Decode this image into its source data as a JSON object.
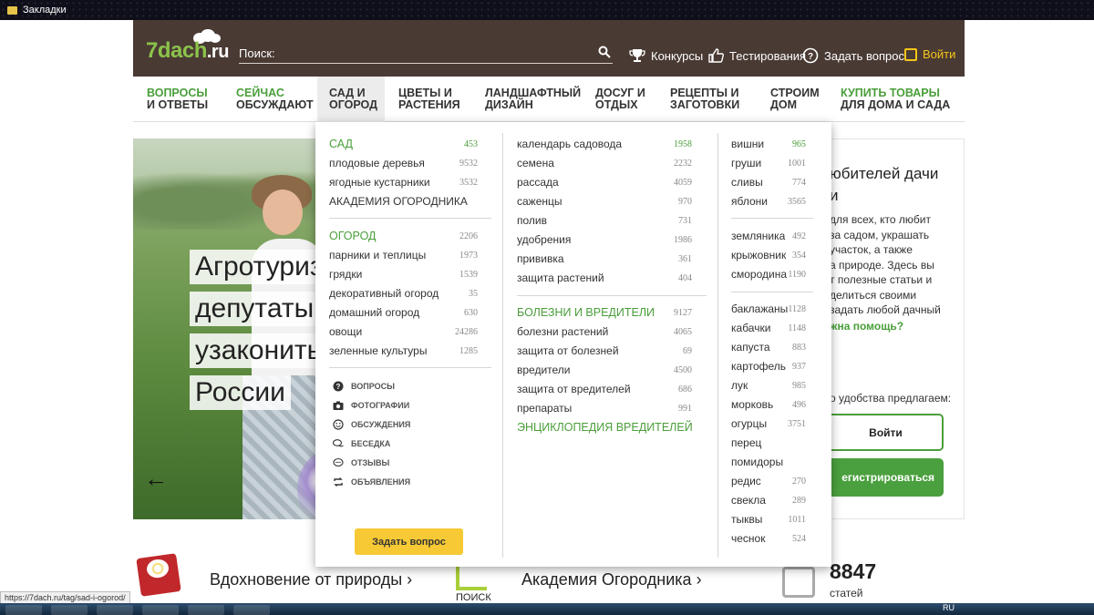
{
  "os": {
    "window_title": "Закладки"
  },
  "header": {
    "logo_main": "7dach",
    "logo_tld": ".ru",
    "search_placeholder": "Поиск:",
    "links": {
      "contests": "Конкурсы",
      "tests": "Тестирования",
      "ask": "Задать вопрос",
      "login": "Войти"
    }
  },
  "nav": [
    {
      "l1": "ВОПРОСЫ",
      "l2": "И ОТВЕТЫ"
    },
    {
      "l1": "СЕЙЧАС",
      "l2": "ОБСУЖДАЮТ"
    },
    {
      "l1": "САД И",
      "l2": "ОГОРОД"
    },
    {
      "l1": "ЦВЕТЫ И",
      "l2": "РАСТЕНИЯ"
    },
    {
      "l1": "ЛАНДШАФТНЫЙ",
      "l2": "ДИЗАЙН"
    },
    {
      "l1": "ДОСУГ И",
      "l2": "ОТДЫХ"
    },
    {
      "l1": "РЕЦЕПТЫ И",
      "l2": "ЗАГОТОВКИ"
    },
    {
      "l1": "СТРОИМ",
      "l2": "ДОМ"
    },
    {
      "l1": "КУПИТЬ ТОВАРЫ",
      "l2": "ДЛЯ ДОМА И САДА"
    }
  ],
  "hero": {
    "lines": [
      "Агротуриз",
      "депутаты",
      "узаконить",
      "России"
    ],
    "arrow": "←"
  },
  "right_panel": {
    "title_l1": "юбителей дачи",
    "title_l2": "и",
    "text": [
      "для всех, кто любит",
      "за садом, украшать",
      "участок, а также",
      "а природе. Здесь вы",
      "т полезные статьи и",
      "делиться своими",
      "задать любой дачный"
    ],
    "help": "жна помощь?",
    "offer": "о удобства предлагаем:",
    "login_btn": "Войти",
    "register_btn": "егистрироваться"
  },
  "dropdown": {
    "col1": {
      "sad_head": "САД",
      "sad_count": "453",
      "sad_items": [
        {
          "label": "плодовые деревья",
          "count": "9532"
        },
        {
          "label": "ягодные кустарники",
          "count": "3532"
        }
      ],
      "academy": "АКАДЕМИЯ ОГОРОДНИКА",
      "ogorod_head": "ОГОРОД",
      "ogorod_count": "2206",
      "ogorod_items": [
        {
          "label": "парники и теплицы",
          "count": "1973"
        },
        {
          "label": "грядки",
          "count": "1539"
        },
        {
          "label": "декоративный огород",
          "count": "35"
        },
        {
          "label": "домашний огород",
          "count": "630"
        },
        {
          "label": "овощи",
          "count": "24286"
        },
        {
          "label": "зеленные культуры",
          "count": "1285"
        }
      ],
      "links": [
        "вопросы",
        "фотографии",
        "обсуждения",
        "беседка",
        "отзывы",
        "объявления"
      ],
      "ask_button": "Задать вопрос"
    },
    "col2": {
      "items": [
        {
          "label": "календарь садовода",
          "count": "1958"
        },
        {
          "label": "семена",
          "count": "2232"
        },
        {
          "label": "рассада",
          "count": "4059"
        },
        {
          "label": "саженцы",
          "count": "970"
        },
        {
          "label": "полив",
          "count": "731"
        },
        {
          "label": "удобрения",
          "count": "1986"
        },
        {
          "label": "прививка",
          "count": "361"
        },
        {
          "label": "защита растений",
          "count": "404"
        }
      ],
      "pests_head": "БОЛЕЗНИ И ВРЕДИТЕЛИ",
      "pests_count": "9127",
      "pests_items": [
        {
          "label": "болезни растений",
          "count": "4065"
        },
        {
          "label": "защита от болезней",
          "count": "69"
        },
        {
          "label": "вредители",
          "count": "4500"
        },
        {
          "label": "защита от вредителей",
          "count": "686"
        },
        {
          "label": "препараты",
          "count": "991"
        }
      ],
      "encyclopedia": "ЭНЦИКЛОПЕДИЯ ВРЕДИТЕЛЕЙ"
    },
    "col3": {
      "group1": [
        {
          "label": "вишни",
          "count": "965"
        },
        {
          "label": "груши",
          "count": "1001"
        },
        {
          "label": "сливы",
          "count": "774"
        },
        {
          "label": "яблони",
          "count": "3565"
        }
      ],
      "group2": [
        {
          "label": "земляника",
          "count": "492"
        },
        {
          "label": "крыжовник",
          "count": "354"
        },
        {
          "label": "смородина",
          "count": "1190"
        }
      ],
      "group3": [
        {
          "label": "баклажаны",
          "count": "1128"
        },
        {
          "label": "кабачки",
          "count": "1148"
        },
        {
          "label": "капуста",
          "count": "883"
        },
        {
          "label": "картофель",
          "count": "937"
        },
        {
          "label": "лук",
          "count": "985"
        },
        {
          "label": "морковь",
          "count": "496"
        },
        {
          "label": "огурцы",
          "count": "3751"
        },
        {
          "label": "перец",
          "count": ""
        },
        {
          "label": "помидоры",
          "count": ""
        },
        {
          "label": "редис",
          "count": "270"
        },
        {
          "label": "свекла",
          "count": "289"
        },
        {
          "label": "тыквы",
          "count": "1011"
        },
        {
          "label": "чеснок",
          "count": "524"
        }
      ]
    }
  },
  "bottom": {
    "inspiration": "Вдохновение от природы ›",
    "poisk": "ПОИСК",
    "academy": "Академия Огородника ›",
    "articles_num": "8847",
    "articles_label": "статей"
  },
  "status_url": "https://7dach.ru/tag/sad-i-ogorod/",
  "taskbar": {
    "lang": "RU"
  },
  "colors": {
    "header_bg": "#4a3a34",
    "green": "#4a9e3a",
    "yellow": "#f6c935"
  }
}
